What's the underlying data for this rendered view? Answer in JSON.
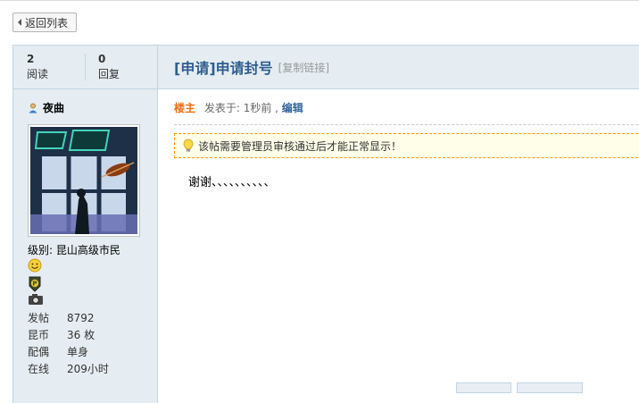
{
  "nav": {
    "back_label": "返回列表"
  },
  "stats": {
    "views_value": "2",
    "views_label": "阅读",
    "replies_value": "0",
    "replies_label": "回复"
  },
  "thread": {
    "title": "[申请]申请封号",
    "copy_link": "[复制链接]"
  },
  "post": {
    "floor_label": "楼主",
    "posted_prefix": "发表于: 1秒前 ,",
    "edit_label": "编辑",
    "notice": "该帖需要管理员审核通过后才能正常显示！",
    "body": "谢谢、、、、、、、、、、"
  },
  "user": {
    "name": "夜曲",
    "level": "级别: 昆山高级市民",
    "info": [
      {
        "key": "发帖",
        "value": "8792"
      },
      {
        "key": "昆币",
        "value": "36 枚"
      },
      {
        "key": "配偶",
        "value": "单身"
      },
      {
        "key": "在线",
        "value": "209小时"
      }
    ]
  },
  "icons": [
    "triangle-left-icon",
    "user-icon",
    "lightbulb-icon",
    "smiley-icon",
    "p-medal-icon",
    "camera-icon"
  ],
  "colors": {
    "title": "#2f5e8e",
    "floor": "#f26c0f",
    "accent_border": "#c2d5e3",
    "side_bg": "#e5edf2"
  }
}
